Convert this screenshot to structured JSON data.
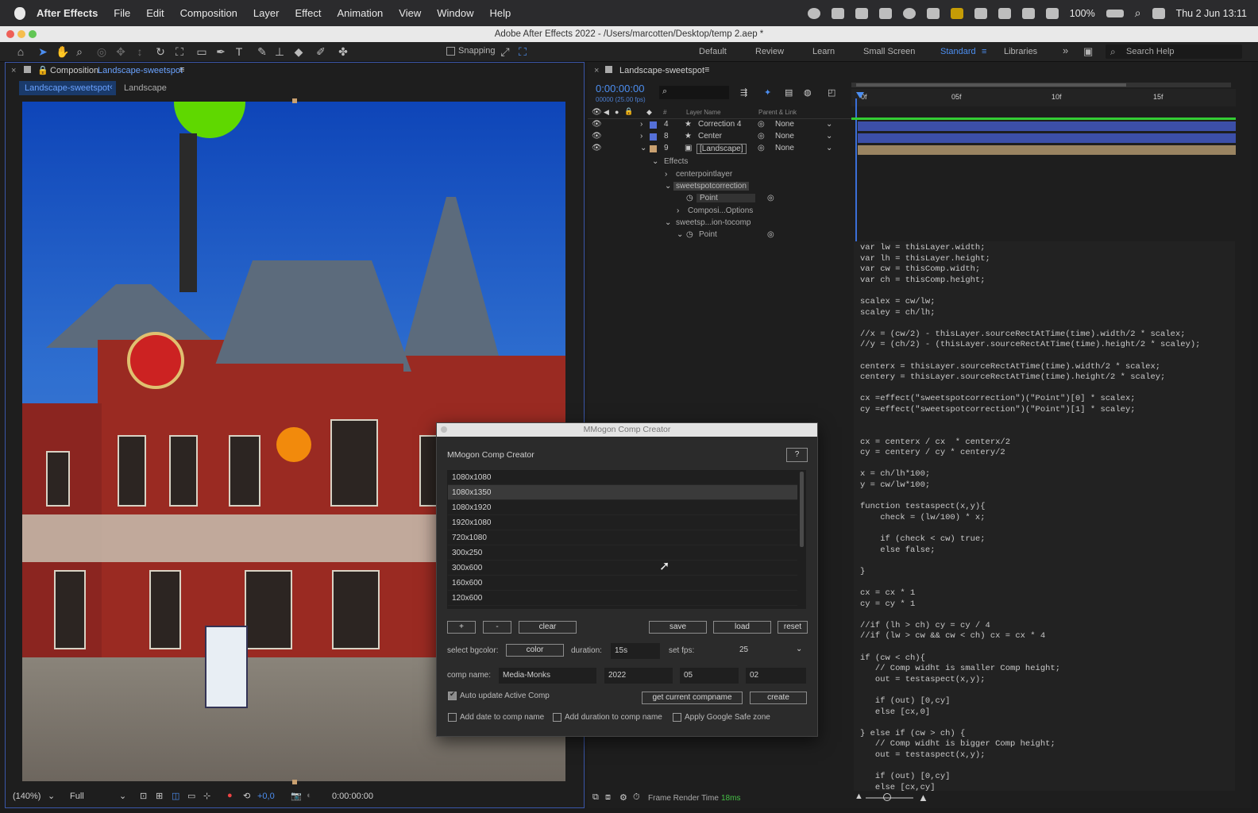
{
  "menubar": {
    "app": "After Effects",
    "items": [
      "File",
      "Edit",
      "Composition",
      "Layer",
      "Effect",
      "Animation",
      "View",
      "Window",
      "Help"
    ],
    "battery": "100%",
    "clock": "Thu 2 Jun  13:11"
  },
  "window": {
    "title": "Adobe After Effects 2022 - /Users/marcotten/Desktop/temp 2.aep *"
  },
  "toolbar": {
    "snapping": "Snapping",
    "workspaces": [
      "Default",
      "Review",
      "Learn",
      "Small Screen",
      "Standard",
      "Libraries"
    ],
    "active_workspace": "Standard",
    "search_placeholder": "Search Help"
  },
  "comp_panel": {
    "tab_prefix": "Composition",
    "tab_name": "Landscape-sweetspot",
    "crumb_active": "Landscape-sweetspot",
    "crumb_other": "Landscape",
    "zoom": "(140%)",
    "resolution": "Full",
    "exposure": "+0,0",
    "timecode": "0:00:00:00"
  },
  "timeline": {
    "tab": "Landscape-sweetspot",
    "timecode": "0:00:00:00",
    "fps_note": "00000 (25.00 fps)",
    "col_layer": "Layer Name",
    "col_parent": "Parent & Link",
    "col_num": "#",
    "ruler": [
      "0f",
      "05f",
      "10f",
      "15f"
    ],
    "layers": [
      {
        "num": "4",
        "name": "Correction 4",
        "parent": "None"
      },
      {
        "num": "8",
        "name": "Center",
        "parent": "None"
      },
      {
        "num": "9",
        "name": "[Landscape]",
        "parent": "None"
      }
    ],
    "effects": {
      "header": "Effects",
      "e1": "centerpointlayer",
      "e2": "sweetspotcorrection",
      "e2_prop": "Point",
      "e2_sub": "Composi...Options",
      "e3": "sweetsp...ion-tocomp",
      "e3_prop": "Point"
    },
    "footer": "Frame Render Time",
    "render_time": "18ms"
  },
  "code": "var lw = thisLayer.width;\nvar lh = thisLayer.height;\nvar cw = thisComp.width;\nvar ch = thisComp.height;\n\nscalex = cw/lw;\nscaley = ch/lh;\n\n//x = (cw/2) - thisLayer.sourceRectAtTime(time).width/2 * scalex;\n//y = (ch/2) - (thisLayer.sourceRectAtTime(time).height/2 * scaley);\n\ncenterx = thisLayer.sourceRectAtTime(time).width/2 * scalex;\ncentery = thisLayer.sourceRectAtTime(time).height/2 * scaley;\n\ncx =effect(\"sweetspotcorrection\")(\"Point\")[0] * scalex;\ncy =effect(\"sweetspotcorrection\")(\"Point\")[1] * scaley;\n\n\ncx = centerx / cx  * centerx/2\ncy = centery / cy * centery/2\n\nx = ch/lh*100;\ny = cw/lw*100;\n\nfunction testaspect(x,y){\n    check = (lw/100) * x;\n\n    if (check < cw) true;\n    else false;\n\n}\n\ncx = cx * 1\ncy = cy * 1\n\n//if (lh > ch) cy = cy / 4\n//if (lw > cw && cw < ch) cx = cx * 4\n\nif (cw < ch){\n   // Comp widht is smaller Comp height;\n   out = testaspect(x,y);\n\n   if (out) [0,cy]\n   else [cx,0]\n\n} else if (cw > ch) {\n   // Comp widht is bigger Comp height;\n   out = testaspect(x,y);\n\n   if (out) [0,cy]\n   else [cx,cy]",
  "dialog": {
    "title": "MMogon Comp Creator",
    "heading": "MMogon Comp Creator",
    "help": "?",
    "sizes": [
      "1080x1080",
      "1080x1350",
      "1080x1920",
      "1920x1080",
      "720x1080",
      "300x250",
      "300x600",
      "160x600",
      "120x600"
    ],
    "selected": "1080x1350",
    "btn_add": "+",
    "btn_remove": "-",
    "btn_clear": "clear",
    "btn_save": "save",
    "btn_load": "load",
    "btn_reset": "reset",
    "bg_label": "select bgcolor:",
    "btn_color": "color",
    "dur_label": "duration:",
    "duration": "15s",
    "fps_label": "set fps:",
    "fps": "25",
    "name_label": "comp name:",
    "name": "Media-Monks",
    "year": "2022",
    "month": "05",
    "day": "02",
    "auto_update": "Auto update Active Comp",
    "btn_getname": "get current compname",
    "btn_create": "create",
    "add_date": "Add date to comp name",
    "add_duration": "Add duration to comp name",
    "safe_zone": "Apply Google Safe zone"
  }
}
